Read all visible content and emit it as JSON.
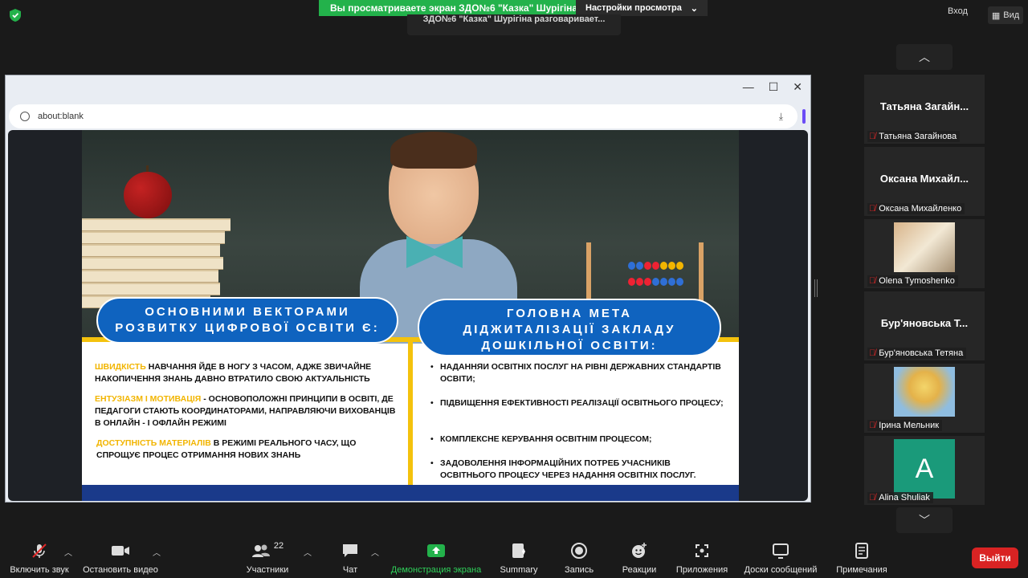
{
  "top": {
    "share_banner_text": "Вы просматриваете экран ЗДО№6 \"Казка\" Шурігіна",
    "view_settings_label": "Настройки просмотра",
    "speaker_text": "ЗДО№6 \"Казка\" Шурігіна разговаривает...",
    "exit_label": "Вход",
    "view_label": "Вид"
  },
  "browser": {
    "url": "about:blank"
  },
  "slide": {
    "pill_left": [
      "ОСНОВНИМИ ВЕКТОРАМИ",
      "РОЗВИТКУ ЦИФРОВОЇ ОСВІТИ Є:"
    ],
    "pill_right": [
      "ГОЛОВНА МЕТА",
      "ДІДЖИТАЛІЗАЦІЇ ЗАКЛАДУ",
      "ДОШКІЛЬНОЇ ОСВІТИ:"
    ],
    "left_items": [
      {
        "highlight": "ШВИДКІСТЬ",
        "text": "  НАВЧАННЯ ЙДЕ В НОГУ З ЧАСОМ, АДЖЕ ЗВИЧАЙНЕ НАКОПИЧЕННЯ ЗНАНЬ ДАВНО ВТРАТИЛО СВОЮ АКТУАЛЬНІСТЬ"
      },
      {
        "highlight": "ЕНТУЗІАЗМ І МОТИВАЦІЯ",
        "text": " - ОСНОВОПОЛОЖНІ ПРИНЦИПИ В ОСВІТІ, ДЕ ПЕДАГОГИ СТАЮТЬ КООРДИНАТОРАМИ, НАПРАВЛЯЮЧИ ВИХОВАНЦІВ В ОНЛАЙН - І ОФЛАЙН РЕЖИМІ"
      },
      {
        "highlight": "ДОСТУПНІСТЬ МАТЕРІАЛІВ",
        "text": " В  РЕЖИМІ РЕАЛЬНОГО ЧАСУ, ЩО СПРОЩУЄ ПРОЦЕС ОТРИМАННЯ НОВИХ ЗНАНЬ"
      }
    ],
    "right_items": [
      "НАДАННЯИ ОСВІТНІХ ПОСЛУГ НА РІВНІ ДЕРЖАВНИХ СТАНДАРТІВ  ОСВІТИ;",
      "ПІДВИЩЕННЯ ЕФЕКТИВНОСТІ РЕАЛІЗАЦІЇ ОСВІТНЬОГО ПРОЦЕСУ;",
      "КОМПЛЕКСНЕ КЕРУВАННЯ ОСВІТНІМ ПРОЦЕСОМ;",
      "ЗАДОВОЛЕННЯ ІНФОРМАЦІЙНИХ ПОТРЕБ УЧАСНИКІВ ОСВІТНЬОГО ПРОЦЕСУ ЧЕРЕЗ НАДАННЯ ОСВІТНІХ ПОСЛУГ."
    ]
  },
  "participants": [
    {
      "display": "Татьяна  Загайн...",
      "label": "Татьяна Загайнова"
    },
    {
      "display": "Оксана  Михайл...",
      "label": "Оксана Михайленко"
    },
    {
      "display": "",
      "label": "Olena Tymoshenko"
    },
    {
      "display": "Бур'яновська  Т...",
      "label": "Бур'яновська Тетяна"
    },
    {
      "display": "",
      "label": "Ірина Мельник"
    },
    {
      "display": "A",
      "label": "Alina Shuliak"
    }
  ],
  "toolbar": {
    "audio": "Включить звук",
    "video": "Остановить видео",
    "participants": "Участники",
    "participants_count": "22",
    "chat": "Чат",
    "share": "Демонстрация экрана",
    "summary": "Summary",
    "record": "Запись",
    "reactions": "Реакции",
    "apps": "Приложения",
    "whiteboards": "Доски сообщений",
    "notes": "Примечания",
    "leave": "Выйти"
  },
  "colors": {
    "share_green": "#23b24b",
    "slide_blue": "#0f63bf",
    "slide_yellow": "#f4c20d",
    "leave_red": "#d92323",
    "alina_avatar": "#1a9a7a"
  }
}
